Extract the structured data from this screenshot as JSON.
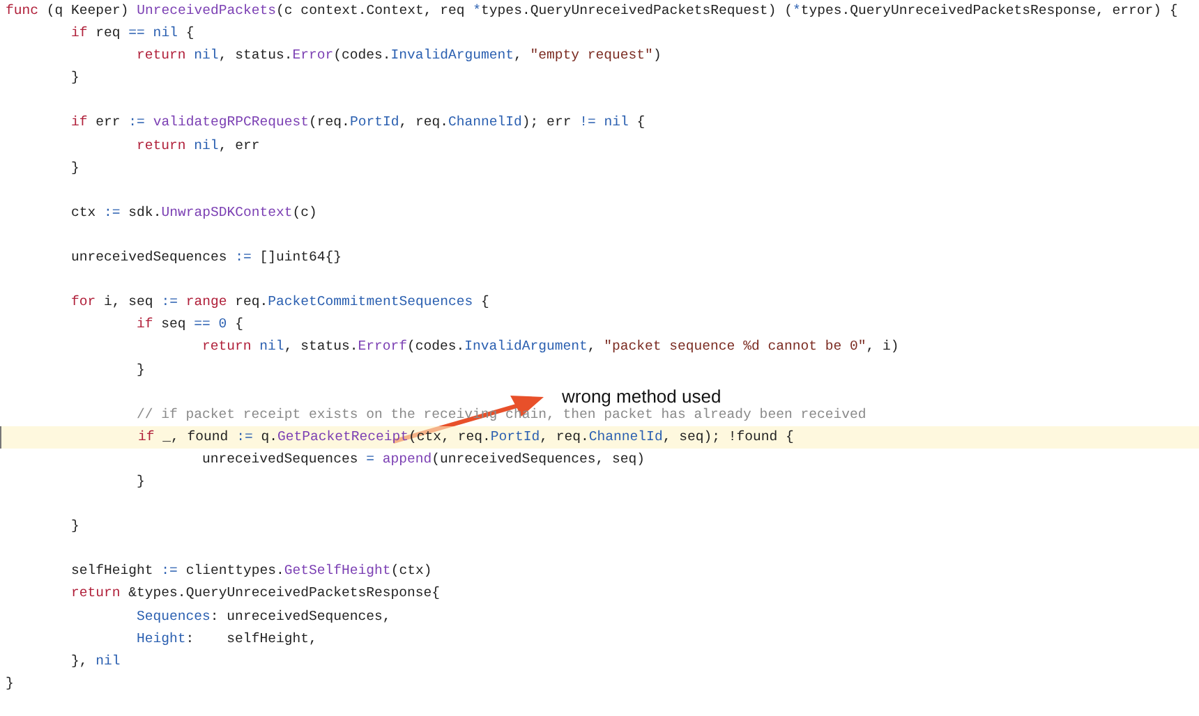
{
  "editor": {
    "lines": [
      {
        "current": false,
        "tokens": [
          {
            "kind": "kw",
            "text": "func"
          },
          {
            "kind": "plain",
            "text": " (q Keeper) "
          },
          {
            "kind": "fn",
            "text": "UnreceivedPackets"
          },
          {
            "kind": "plain",
            "text": "(c context.Context, req "
          },
          {
            "kind": "id",
            "text": "*"
          },
          {
            "kind": "plain",
            "text": "types.QueryUnreceivedPacketsRequest) ("
          },
          {
            "kind": "id",
            "text": "*"
          },
          {
            "kind": "plain",
            "text": "types.QueryUnreceivedPacketsResponse, error) {"
          }
        ],
        "children": [
          {
            "current": false,
            "tokens": [
              {
                "kind": "kw",
                "text": "if"
              },
              {
                "kind": "plain",
                "text": " req "
              },
              {
                "kind": "id",
                "text": "== nil"
              },
              {
                "kind": "plain",
                "text": " {"
              }
            ],
            "children": [
              {
                "current": false,
                "tokens": [
                  {
                    "kind": "kw",
                    "text": "return"
                  },
                  {
                    "kind": "id",
                    "text": " nil"
                  },
                  {
                    "kind": "plain",
                    "text": ", status."
                  },
                  {
                    "kind": "fn",
                    "text": "Error"
                  },
                  {
                    "kind": "plain",
                    "text": "(codes."
                  },
                  {
                    "kind": "id",
                    "text": "InvalidArgument"
                  },
                  {
                    "kind": "plain",
                    "text": ", "
                  },
                  {
                    "kind": "str",
                    "text": "\"empty request\""
                  },
                  {
                    "kind": "plain",
                    "text": ")"
                  }
                ]
              }
            ]
          },
          {
            "current": false,
            "space_after": true,
            "tokens": [
              {
                "kind": "plain",
                "text": "}"
              }
            ]
          },
          {
            "current": false,
            "tokens": [
              {
                "kind": "kw",
                "text": "if"
              },
              {
                "kind": "plain",
                "text": " err "
              },
              {
                "kind": "id",
                "text": ":="
              },
              {
                "kind": "fn",
                "text": " validategRPCRequest"
              },
              {
                "kind": "plain",
                "text": "(req."
              },
              {
                "kind": "id",
                "text": "PortId"
              },
              {
                "kind": "plain",
                "text": ", req."
              },
              {
                "kind": "id",
                "text": "ChannelId"
              },
              {
                "kind": "plain",
                "text": "); err "
              },
              {
                "kind": "id",
                "text": "!= nil"
              },
              {
                "kind": "plain",
                "text": " {"
              }
            ],
            "children": [
              {
                "current": false,
                "tokens": [
                  {
                    "kind": "kw",
                    "text": "return"
                  },
                  {
                    "kind": "id",
                    "text": " nil"
                  },
                  {
                    "kind": "plain",
                    "text": ", err"
                  }
                ]
              }
            ]
          },
          {
            "current": false,
            "space_after": true,
            "tokens": [
              {
                "kind": "plain",
                "text": "}"
              }
            ]
          },
          {
            "current": false,
            "space_after": true,
            "tokens": [
              {
                "kind": "plain",
                "text": "ctx "
              },
              {
                "kind": "id",
                "text": ":="
              },
              {
                "kind": "plain",
                "text": " sdk."
              },
              {
                "kind": "fn",
                "text": "UnwrapSDKContext"
              },
              {
                "kind": "plain",
                "text": "(c)"
              }
            ]
          },
          {
            "current": false,
            "space_after": true,
            "tokens": [
              {
                "kind": "plain",
                "text": "unreceivedSequences "
              },
              {
                "kind": "id",
                "text": ":="
              },
              {
                "kind": "plain",
                "text": " []uint64{}"
              }
            ]
          },
          {
            "current": false,
            "tokens": [
              {
                "kind": "kw",
                "text": "for"
              },
              {
                "kind": "plain",
                "text": " i, seq "
              },
              {
                "kind": "id",
                "text": ":="
              },
              {
                "kind": "kw",
                "text": " range"
              },
              {
                "kind": "plain",
                "text": " req."
              },
              {
                "kind": "id",
                "text": "PacketCommitmentSequences"
              },
              {
                "kind": "plain",
                "text": " {"
              }
            ],
            "children": [
              {
                "current": false,
                "tokens": [
                  {
                    "kind": "kw",
                    "text": "if"
                  },
                  {
                    "kind": "plain",
                    "text": " seq "
                  },
                  {
                    "kind": "id",
                    "text": "== 0"
                  },
                  {
                    "kind": "plain",
                    "text": " {"
                  }
                ],
                "children": [
                  {
                    "current": false,
                    "tokens": [
                      {
                        "kind": "kw",
                        "text": "return"
                      },
                      {
                        "kind": "id",
                        "text": " nil"
                      },
                      {
                        "kind": "plain",
                        "text": ", status."
                      },
                      {
                        "kind": "fn",
                        "text": "Errorf"
                      },
                      {
                        "kind": "plain",
                        "text": "(codes."
                      },
                      {
                        "kind": "id",
                        "text": "InvalidArgument"
                      },
                      {
                        "kind": "plain",
                        "text": ", "
                      },
                      {
                        "kind": "str",
                        "text": "\"packet sequence %d cannot be 0\""
                      },
                      {
                        "kind": "plain",
                        "text": ", i)"
                      }
                    ]
                  }
                ]
              },
              {
                "current": false,
                "space_after": true,
                "tokens": [
                  {
                    "kind": "plain",
                    "text": "}"
                  }
                ]
              },
              {
                "current": false,
                "tokens": [
                  {
                    "kind": "com",
                    "text": "// if packet receipt exists on the receiving chain, then packet has already been received"
                  }
                ]
              },
              {
                "current": true,
                "tokens": [
                  {
                    "kind": "kw",
                    "text": "if"
                  },
                  {
                    "kind": "plain",
                    "text": " _, found "
                  },
                  {
                    "kind": "id",
                    "text": ":="
                  },
                  {
                    "kind": "plain",
                    "text": " q."
                  },
                  {
                    "kind": "fn",
                    "text": "GetPacketReceipt"
                  },
                  {
                    "kind": "plain",
                    "text": "(ctx, req."
                  },
                  {
                    "kind": "id",
                    "text": "PortId"
                  },
                  {
                    "kind": "plain",
                    "text": ", req."
                  },
                  {
                    "kind": "id",
                    "text": "ChannelId"
                  },
                  {
                    "kind": "plain",
                    "text": ", seq); !found {"
                  }
                ],
                "children": [
                  {
                    "current": false,
                    "tokens": [
                      {
                        "kind": "plain",
                        "text": "unreceivedSequences "
                      },
                      {
                        "kind": "id",
                        "text": "="
                      },
                      {
                        "kind": "fn",
                        "text": " append"
                      },
                      {
                        "kind": "plain",
                        "text": "(unreceivedSequences, seq)"
                      }
                    ]
                  }
                ]
              },
              {
                "current": false,
                "space_after": true,
                "tokens": [
                  {
                    "kind": "plain",
                    "text": "}"
                  }
                ]
              }
            ]
          },
          {
            "current": false,
            "space_after": true,
            "tokens": [
              {
                "kind": "plain",
                "text": "}"
              }
            ]
          },
          {
            "current": false,
            "tokens": [
              {
                "kind": "plain",
                "text": "selfHeight "
              },
              {
                "kind": "id",
                "text": ":="
              },
              {
                "kind": "plain",
                "text": " clienttypes."
              },
              {
                "kind": "fn",
                "text": "GetSelfHeight"
              },
              {
                "kind": "plain",
                "text": "(ctx)"
              }
            ]
          },
          {
            "current": false,
            "tokens": [
              {
                "kind": "kw",
                "text": "return"
              },
              {
                "kind": "plain",
                "text": " &types.QueryUnreceivedPacketsResponse{"
              }
            ],
            "children": [
              {
                "current": false,
                "tokens": [
                  {
                    "kind": "id",
                    "text": "Sequences"
                  },
                  {
                    "kind": "plain",
                    "text": ": unreceivedSequences,"
                  }
                ]
              },
              {
                "current": false,
                "tokens": [
                  {
                    "kind": "id",
                    "text": "Height"
                  },
                  {
                    "kind": "plain",
                    "text": ":    selfHeight,"
                  }
                ]
              }
            ]
          },
          {
            "current": false,
            "tokens": [
              {
                "kind": "plain",
                "text": "}, "
              },
              {
                "kind": "id",
                "text": "nil"
              }
            ]
          }
        ]
      },
      {
        "current": false,
        "tokens": [
          {
            "kind": "plain",
            "text": "}"
          }
        ]
      }
    ]
  },
  "annotation": {
    "text": "wrong method used"
  }
}
